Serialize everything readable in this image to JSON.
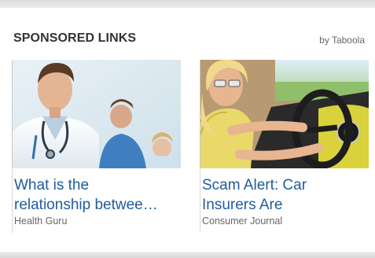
{
  "widget": {
    "title": "SPONSORED LINKS",
    "attribution": "by Taboola"
  },
  "cards": [
    {
      "headline_line1": "What is the",
      "headline_line2": "relationship betwee…",
      "source": "Health Guru",
      "image_icon": "doctor-photo"
    },
    {
      "headline_line1": "Scam Alert: Car",
      "headline_line2": "Insurers Are",
      "source": "Consumer Journal",
      "image_icon": "woman-driving-photo"
    }
  ],
  "colors": {
    "headline_link": "#1f5c9c",
    "title_text": "#333333",
    "source_text": "#666666"
  }
}
